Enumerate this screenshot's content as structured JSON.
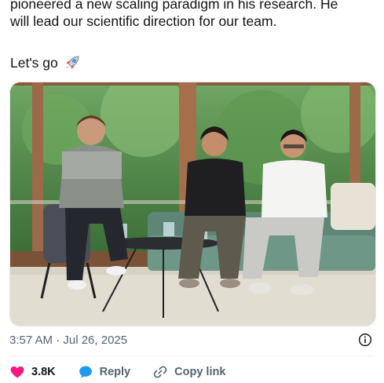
{
  "tweet": {
    "line1": "pioneered a new scaling paradigm in his research. He",
    "line2": "will lead our scientific direction for our team.",
    "line3": "Let's go",
    "emoji_icon": "rocket-icon"
  },
  "meta": {
    "timestamp": "3:57 AM · Jul 26, 2025",
    "info_icon": "info-icon"
  },
  "actions": {
    "likes": "3.8K",
    "reply_label": "Reply",
    "copy_label": "Copy link",
    "like_color": "#f91880",
    "reply_color": "#1d9bf0"
  }
}
